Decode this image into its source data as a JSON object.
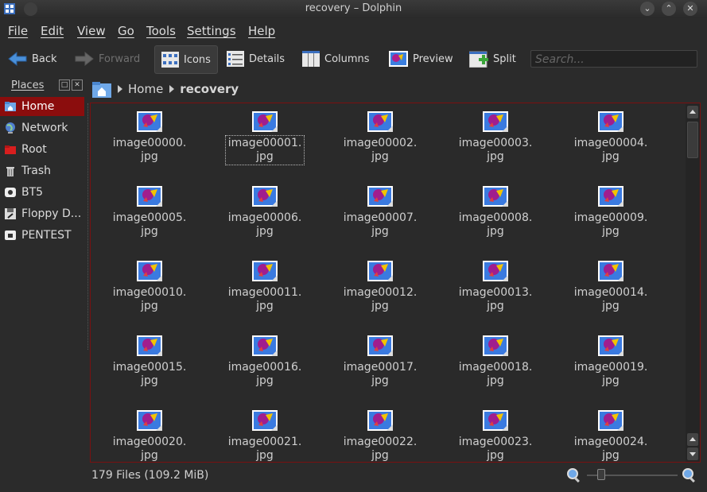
{
  "window": {
    "title": "recovery – Dolphin"
  },
  "menu": [
    "File",
    "Edit",
    "View",
    "Go",
    "Tools",
    "Settings",
    "Help"
  ],
  "toolbar": {
    "back": "Back",
    "forward": "Forward",
    "icons": "Icons",
    "details": "Details",
    "columns": "Columns",
    "preview": "Preview",
    "split": "Split"
  },
  "search": {
    "placeholder": "Search..."
  },
  "places": {
    "header": "Places",
    "items": [
      {
        "label": "Home",
        "icon": "home-folder-icon",
        "selected": true
      },
      {
        "label": "Network",
        "icon": "globe-icon"
      },
      {
        "label": "Root",
        "icon": "red-folder-icon"
      },
      {
        "label": "Trash",
        "icon": "trash-icon"
      },
      {
        "label": "BT5",
        "icon": "drive-icon"
      },
      {
        "label": "Floppy D...",
        "icon": "floppy-icon"
      },
      {
        "label": "PENTEST",
        "icon": "drive-icon"
      }
    ]
  },
  "breadcrumb": {
    "home": "Home",
    "current": "recovery"
  },
  "files": [
    {
      "line1": "image00000.",
      "line2": "jpg"
    },
    {
      "line1": "image00001.",
      "line2": "jpg",
      "focused": true
    },
    {
      "line1": "image00002.",
      "line2": "jpg"
    },
    {
      "line1": "image00003.",
      "line2": "jpg"
    },
    {
      "line1": "image00004.",
      "line2": "jpg"
    },
    {
      "line1": "image00005.",
      "line2": "jpg"
    },
    {
      "line1": "image00006.",
      "line2": "jpg"
    },
    {
      "line1": "image00007.",
      "line2": "jpg"
    },
    {
      "line1": "image00008.",
      "line2": "jpg"
    },
    {
      "line1": "image00009.",
      "line2": "jpg"
    },
    {
      "line1": "image00010.",
      "line2": "jpg"
    },
    {
      "line1": "image00011.",
      "line2": "jpg"
    },
    {
      "line1": "image00012.",
      "line2": "jpg"
    },
    {
      "line1": "image00013.",
      "line2": "jpg"
    },
    {
      "line1": "image00014.",
      "line2": "jpg"
    },
    {
      "line1": "image00015.",
      "line2": "jpg"
    },
    {
      "line1": "image00016.",
      "line2": "jpg"
    },
    {
      "line1": "image00017.",
      "line2": "jpg"
    },
    {
      "line1": "image00018.",
      "line2": "jpg"
    },
    {
      "line1": "image00019.",
      "line2": "jpg"
    },
    {
      "line1": "image00020.",
      "line2": "jpg"
    },
    {
      "line1": "image00021.",
      "line2": "jpg"
    },
    {
      "line1": "image00022.",
      "line2": "jpg"
    },
    {
      "line1": "image00023.",
      "line2": "jpg"
    },
    {
      "line1": "image00024.",
      "line2": "jpg"
    }
  ],
  "status": {
    "summary": "179 Files (109.2 MiB)"
  },
  "colors": {
    "accent": "#8b0d0d",
    "background": "#2b2b2b",
    "content_border": "#7a1010"
  }
}
